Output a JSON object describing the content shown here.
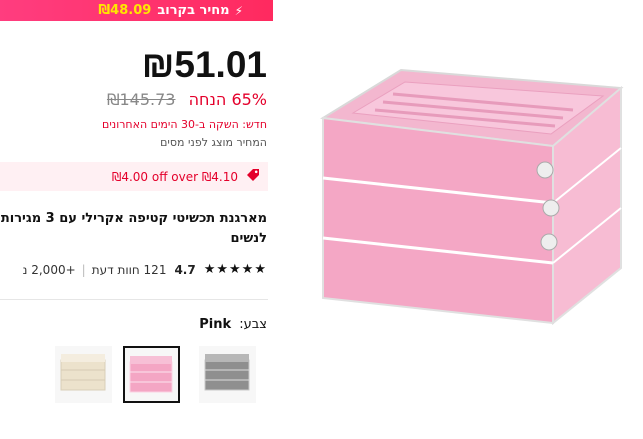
{
  "promo": {
    "label": "מחיר בקרוב",
    "price": "₪48.09"
  },
  "price": {
    "current": "₪51.01",
    "discount": "65% הנחה",
    "original": "₪145.73",
    "note_compare": "חדש: השקה ב-30 הימים האחרונים",
    "note_tax": "המחיר מוצג לפני מסים"
  },
  "coupon": {
    "text": "₪4.00 off over ₪4.10"
  },
  "product": {
    "title": "מארגנת תכשיטי קטיפה אקרילי עם 3 מגירות לנשים"
  },
  "rating": {
    "value": "4.7",
    "reviews": "121 חוות דעת",
    "sold": "+2,000 נ",
    "stars": 5
  },
  "color": {
    "label": "צבע:",
    "selected": "Pink"
  },
  "variants": [
    {
      "name": "gray",
      "color": "#9a9a9a"
    },
    {
      "name": "pink",
      "color": "#f4a6c4"
    },
    {
      "name": "beige",
      "color": "#efe6d2"
    }
  ],
  "icons": {
    "promo": "lightning-icon",
    "coupon": "tag-icon",
    "star": "star-icon"
  },
  "colors": {
    "accent": "#e4002b",
    "promo_bg": "#ff2a5f",
    "promo_price": "#ffe600"
  }
}
